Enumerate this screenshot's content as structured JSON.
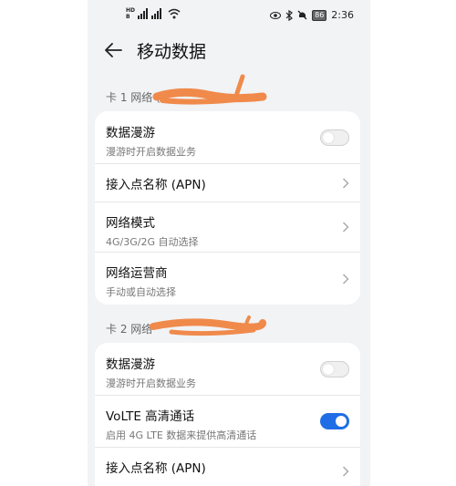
{
  "status_bar": {
    "sim_tags": [
      "HD",
      "B"
    ],
    "time": "2:36",
    "battery": "86",
    "icons": [
      "eye-icon",
      "bluetooth-icon",
      "mute-icon",
      "battery-icon"
    ]
  },
  "header": {
    "title": "移动数据"
  },
  "sim1": {
    "label": "卡 1 网络 (+",
    "items": [
      {
        "title": "数据漫游",
        "sub": "漫游时开启数据业务",
        "control": "toggle",
        "on": false
      },
      {
        "title": "接入点名称 (APN)",
        "sub": "",
        "control": "chevron"
      },
      {
        "title": "网络模式",
        "sub": "4G/3G/2G 自动选择",
        "control": "chevron"
      },
      {
        "title": "网络运营商",
        "sub": "手动或自动选择",
        "control": "chevron"
      }
    ]
  },
  "sim2": {
    "label": "卡 2 网络",
    "items": [
      {
        "title": "数据漫游",
        "sub": "漫游时开启数据业务",
        "control": "toggle",
        "on": false
      },
      {
        "title": "VoLTE 高清通话",
        "sub": "启用 4G LTE 数据来提供高清通话",
        "control": "toggle",
        "on": true
      },
      {
        "title": "接入点名称 (APN)",
        "sub": "",
        "control": "chevron"
      }
    ]
  },
  "colors": {
    "accent": "#1f6ee6",
    "redaction": "#f08a4b",
    "background": "#f1f3f5"
  }
}
